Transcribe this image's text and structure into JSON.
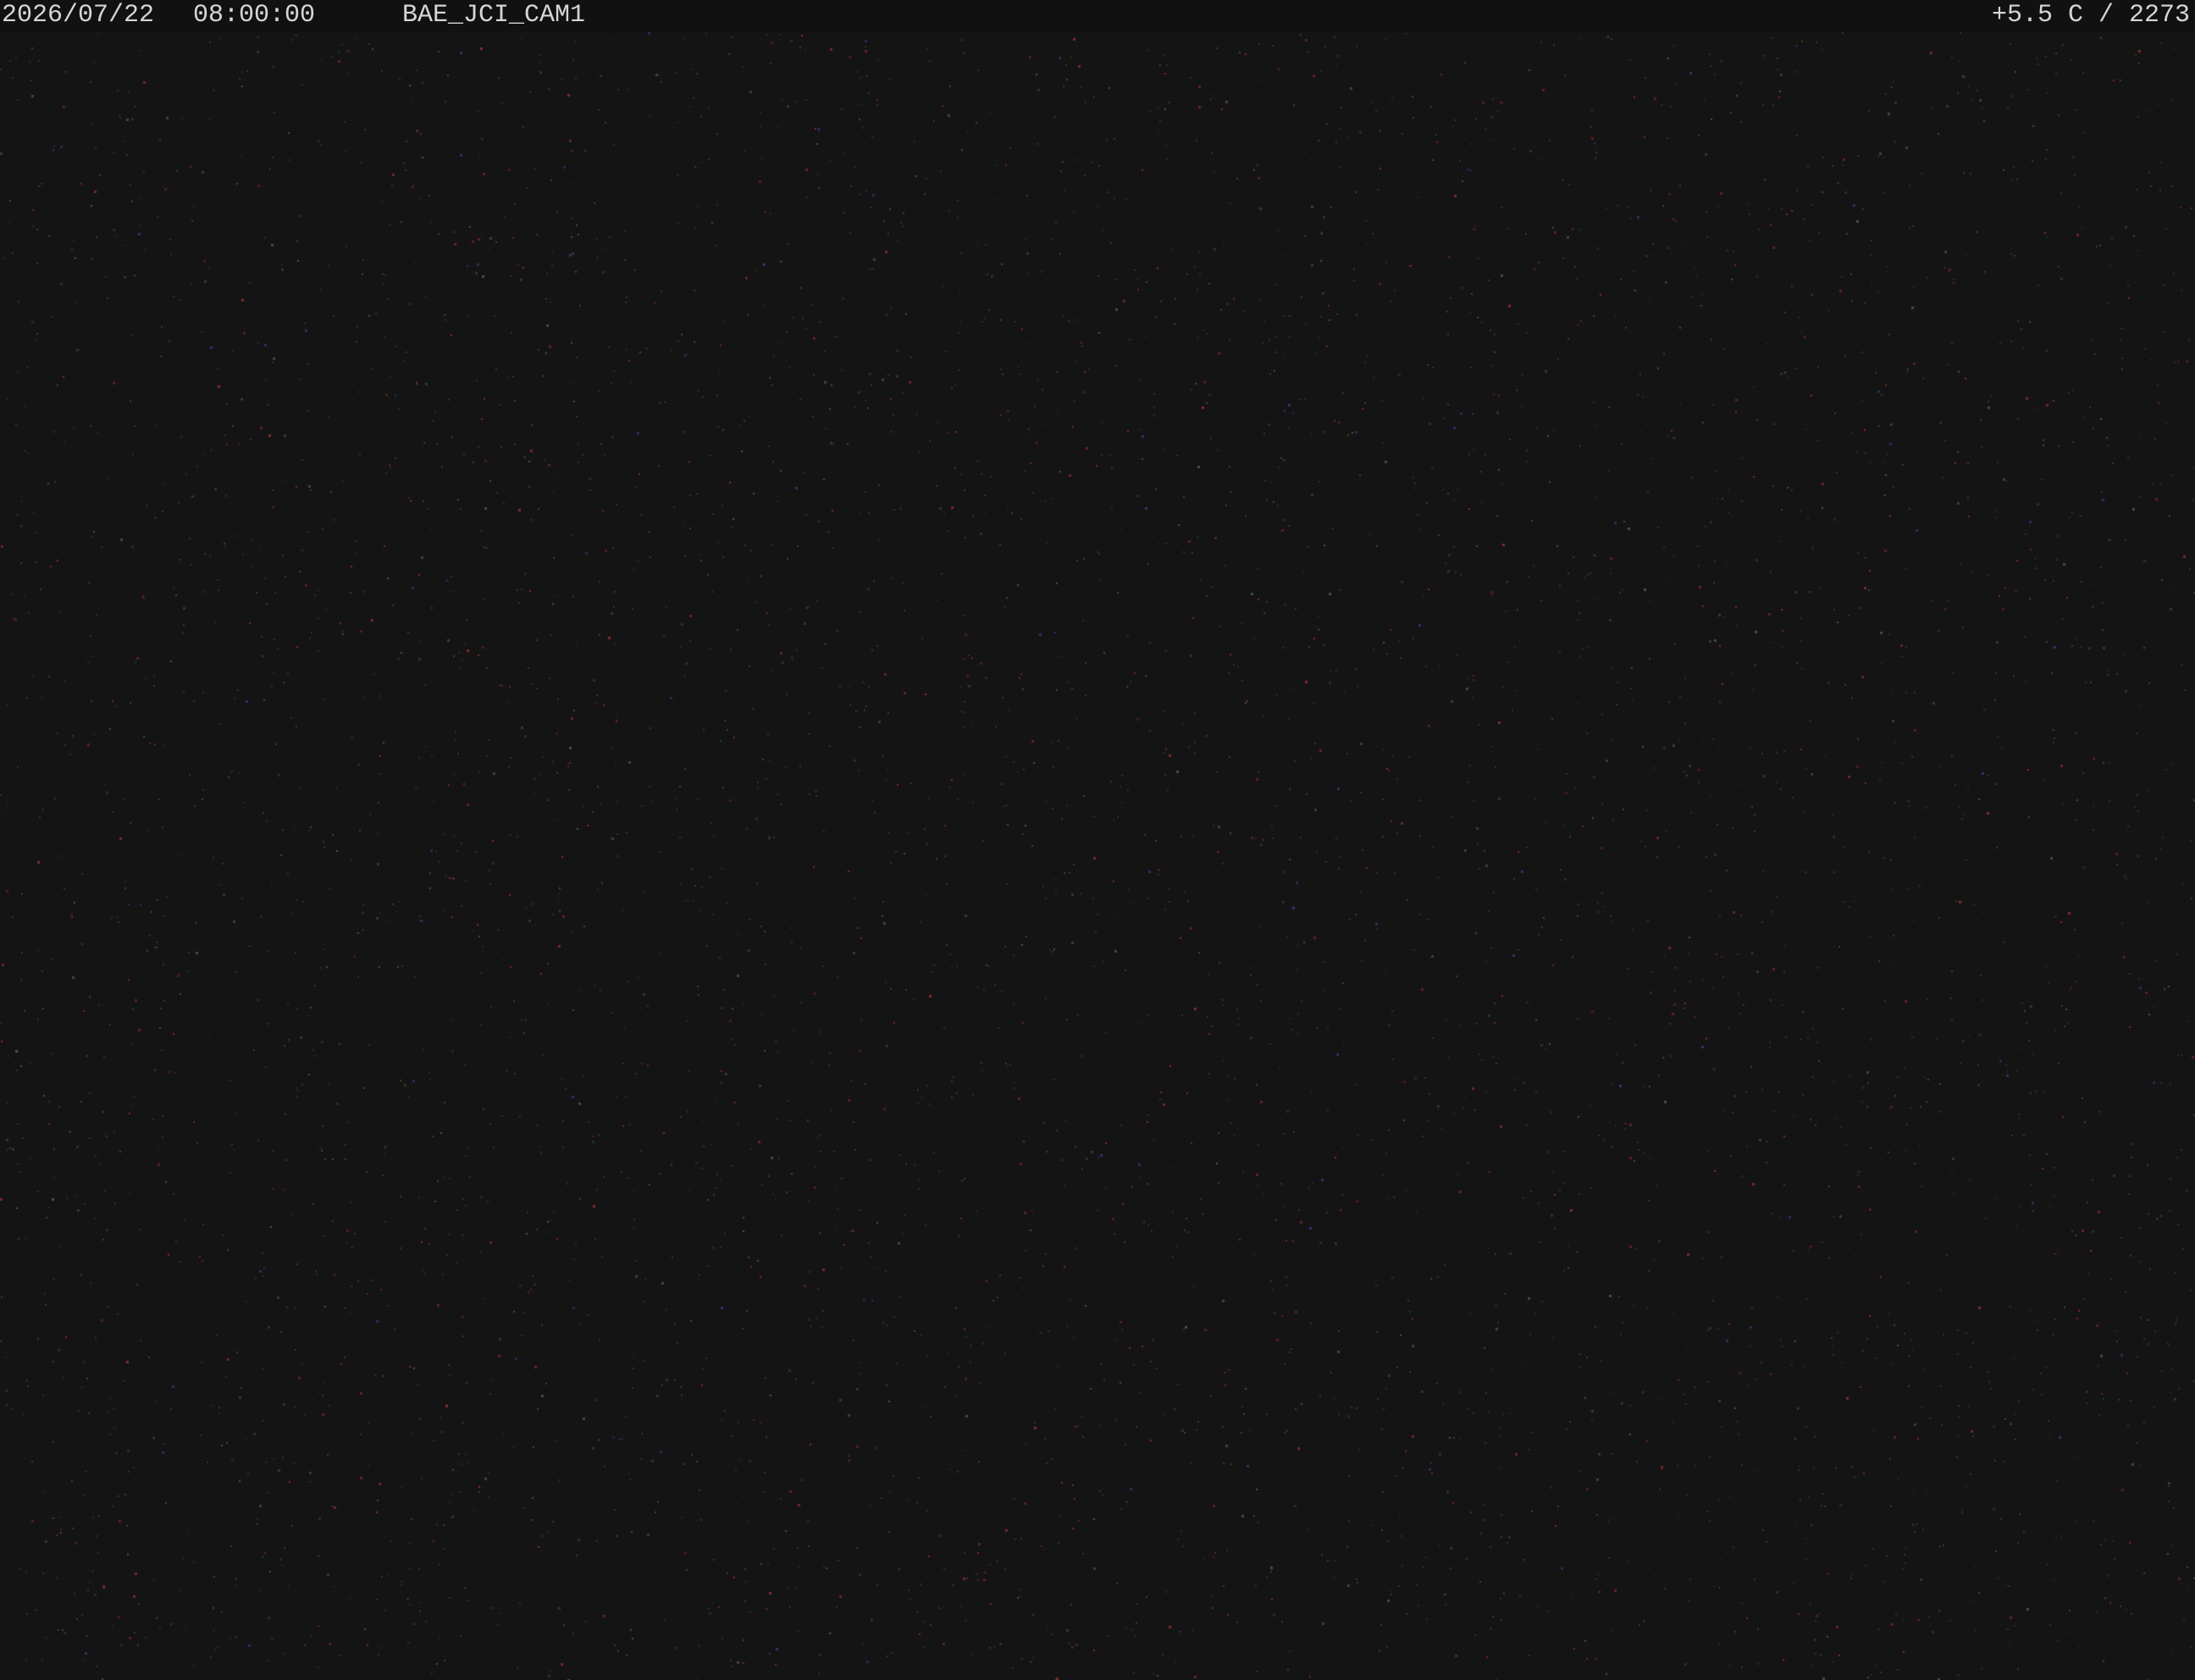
{
  "overlay": {
    "date": "2026/07/22",
    "time": "08:00:00",
    "camera_id": "BAE_JCI_CAM1",
    "sensor_reading": "+5.5 C / 2273"
  },
  "scene": {
    "description_tag": "dark-night-sky-sensor-noise",
    "background_color": "#141414",
    "noise_colors": [
      "#7a2a2a",
      "#a03030",
      "#3a3a7a",
      "#2f4a2f",
      "#5a5a5a"
    ]
  }
}
